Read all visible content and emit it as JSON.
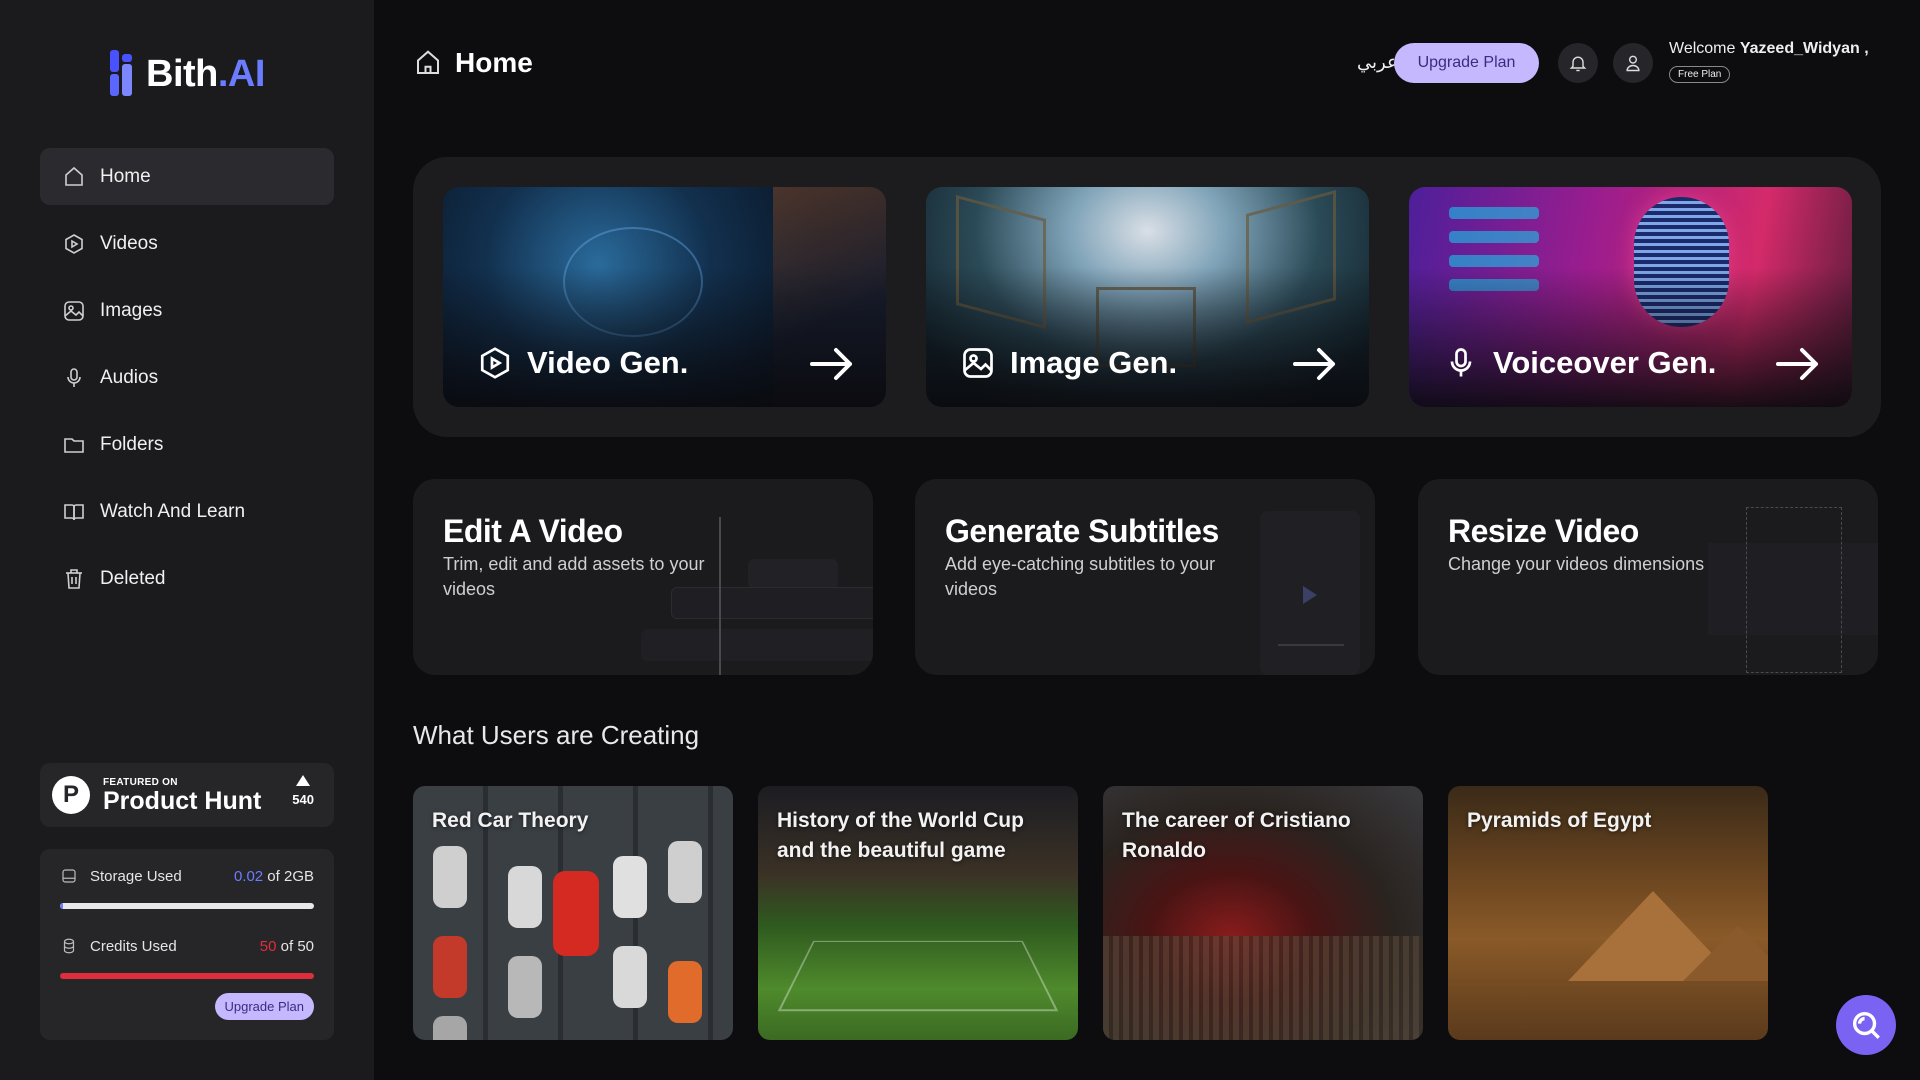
{
  "brand": {
    "name": "Bith",
    "suffix": ".AI"
  },
  "sidebar": {
    "items": [
      {
        "label": "Home",
        "icon": "home-icon"
      },
      {
        "label": "Videos",
        "icon": "video-icon"
      },
      {
        "label": "Images",
        "icon": "image-icon"
      },
      {
        "label": "Audios",
        "icon": "microphone-icon"
      },
      {
        "label": "Folders",
        "icon": "folder-icon"
      },
      {
        "label": "Watch And Learn",
        "icon": "book-icon"
      },
      {
        "label": "Deleted",
        "icon": "trash-icon"
      }
    ],
    "active": "Home"
  },
  "product_hunt": {
    "featured": "FEATURED ON",
    "name": "Product Hunt",
    "votes": "540"
  },
  "usage": {
    "storage": {
      "label": "Storage Used",
      "used": "0.02",
      "total": " of 2GB",
      "fraction": 0.01
    },
    "credits": {
      "label": "Credits Used",
      "used": "50",
      "total": " of 50",
      "fraction": 1.0
    },
    "upgrade_label": "Upgrade Plan"
  },
  "header": {
    "title": "Home",
    "language": "عربي",
    "upgrade_label": "Upgrade Plan",
    "welcome_prefix": "Welcome ",
    "username": "Yazeed_Widyan ,",
    "plan": "Free Plan"
  },
  "gen_cards": [
    {
      "label": "Video Gen.",
      "icon": "play-circle-icon"
    },
    {
      "label": "Image Gen.",
      "icon": "image-icon"
    },
    {
      "label": "Voiceover Gen.",
      "icon": "microphone-icon"
    }
  ],
  "tools": [
    {
      "title": "Edit A Video",
      "desc": "Trim, edit and add assets to your videos"
    },
    {
      "title": "Generate Subtitles",
      "desc": "Add eye-catching subtitles to your videos"
    },
    {
      "title": "Resize Video",
      "desc": "Change your videos dimensions"
    }
  ],
  "section_title": "What Users are Creating",
  "creations": [
    {
      "title": "Red Car Theory"
    },
    {
      "title": "History of the World Cup and the beautiful game"
    },
    {
      "title": "The career of Cristiano Ronaldo"
    },
    {
      "title": "Pyramids of Egypt"
    }
  ],
  "colors": {
    "accent": "#c5b8ff",
    "brand_blue": "#6b7cff",
    "credits_red": "#e02d3c",
    "storage_blue": "#6b7cff",
    "fab": "#7a63f2"
  }
}
